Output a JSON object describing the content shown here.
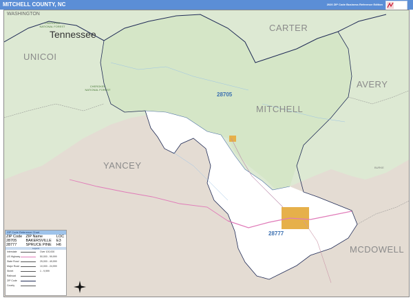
{
  "header": {
    "title": "MITCHELL COUNTY, NC",
    "subtitle": "2020 ZIP Code Business Reference Edition",
    "logo_text": "Market Maps"
  },
  "colors": {
    "header": "#5b8ed6",
    "green_area": "#dde9d3",
    "tan_area": "#e4dcd3",
    "white_area": "#ffffff",
    "orange_city": "#e6b04a",
    "county_border": "#1f2a55",
    "road_pink": "#e07ab8",
    "water": "#9bc3e6"
  },
  "labels": {
    "state": "Tennessee",
    "washington": "WASHINGTON",
    "unicoi": "UNICOI",
    "carter": "CARTER",
    "avery": "AVERY",
    "mitchell": "MITCHELL",
    "yancey": "YANCEY",
    "mcdowell": "MCDOWELL",
    "zip_28705": "28705",
    "zip_28777": "28777",
    "forest_1": "CHEROKEE NATIONAL FOREST",
    "forest_2": "CHEROKEE NATIONAL FOREST",
    "burke": "BURKE"
  },
  "legend": {
    "header": "ZIP Code Reference Chart",
    "columns": [
      "ZIP Code",
      "ZIP Name",
      "LOC"
    ],
    "rows": [
      {
        "zip": "28705",
        "name": "BAKERSVILLE",
        "loc": "E3"
      },
      {
        "zip": "28777",
        "name": "SPRUCE PINE",
        "loc": "H6"
      }
    ],
    "key_header": "Legend",
    "city_symbol": "City\nCity",
    "key_items": [
      {
        "label": "Interstate",
        "note": "Over 100,000"
      },
      {
        "label": "US Highway",
        "note": "50,000 - 99,999"
      },
      {
        "label": "State Road",
        "note": "25,000 - 49,999"
      },
      {
        "label": "Major Road",
        "note": "10,000 - 24,999"
      },
      {
        "label": "Street",
        "note": "1 - 9,999"
      },
      {
        "label": "Railroad",
        "note": ""
      },
      {
        "label": "ZIP Code",
        "note": ""
      },
      {
        "label": "County",
        "note": ""
      },
      {
        "label": "Interstate Hwy",
        "note": ""
      },
      {
        "label": "US Hwy",
        "note": ""
      },
      {
        "label": "State Hwy",
        "note": ""
      },
      {
        "label": "Water",
        "note": ""
      }
    ]
  }
}
